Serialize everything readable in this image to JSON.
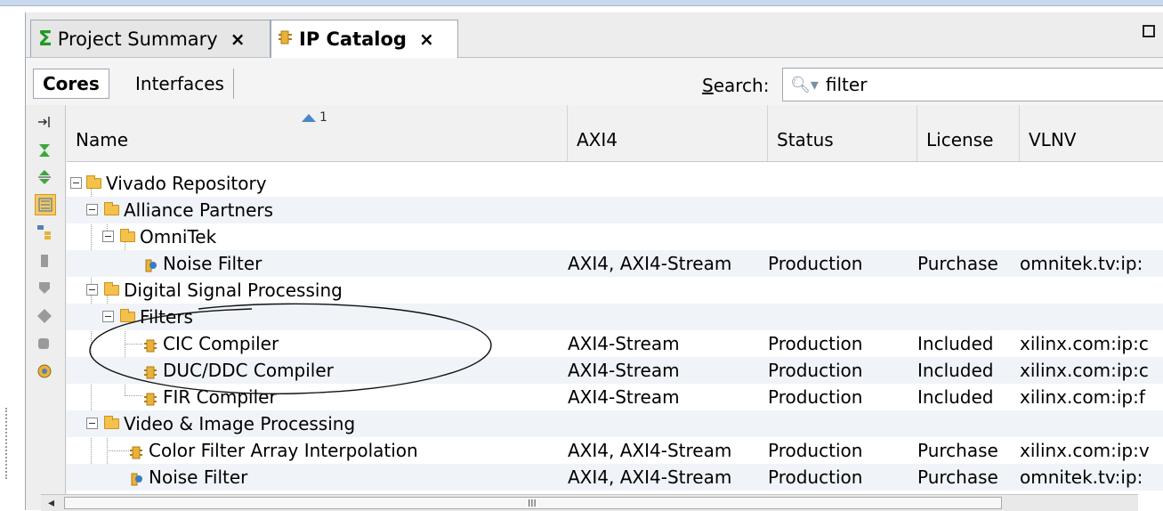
{
  "tabs": [
    {
      "label": "Project Summary",
      "icon": "sigma-icon",
      "active": false
    },
    {
      "label": "IP Catalog",
      "icon": "ip-core-icon",
      "active": true
    }
  ],
  "tab_close": "×",
  "subtabs": {
    "cores": "Cores",
    "interfaces": "Interfaces"
  },
  "search": {
    "label_first": "S",
    "label_rest": "earch:",
    "value": "filter"
  },
  "sort_indicator": "1",
  "columns": [
    "Name",
    "AXI4",
    "Status",
    "License",
    "VLNV"
  ],
  "rows": [
    {
      "name": "Vivado Repository",
      "axi": "",
      "status": "",
      "license": "",
      "vlnv": ""
    },
    {
      "name": "Alliance Partners",
      "axi": "",
      "status": "",
      "license": "",
      "vlnv": ""
    },
    {
      "name": "OmniTek",
      "axi": "",
      "status": "",
      "license": "",
      "vlnv": ""
    },
    {
      "name": "Noise Filter",
      "axi": "AXI4, AXI4-Stream",
      "status": "Production",
      "license": "Purchase",
      "vlnv": "omnitek.tv:ip:"
    },
    {
      "name": "Digital Signal Processing",
      "axi": "",
      "status": "",
      "license": "",
      "vlnv": ""
    },
    {
      "name": "Filters",
      "axi": "",
      "status": "",
      "license": "",
      "vlnv": ""
    },
    {
      "name": "CIC Compiler",
      "axi": "AXI4-Stream",
      "status": "Production",
      "license": "Included",
      "vlnv": "xilinx.com:ip:c"
    },
    {
      "name": "DUC/DDC Compiler",
      "axi": "AXI4-Stream",
      "status": "Production",
      "license": "Included",
      "vlnv": "xilinx.com:ip:c"
    },
    {
      "name": "FIR Compiler",
      "axi": "AXI4-Stream",
      "status": "Production",
      "license": "Included",
      "vlnv": "xilinx.com:ip:f"
    },
    {
      "name": "Video & Image Processing",
      "axi": "",
      "status": "",
      "license": "",
      "vlnv": ""
    },
    {
      "name": "Color Filter Array Interpolation",
      "axi": "AXI4, AXI4-Stream",
      "status": "Production",
      "license": "Purchase",
      "vlnv": "xilinx.com:ip:v"
    },
    {
      "name": "Noise Filter",
      "axi": "AXI4, AXI4-Stream",
      "status": "Production",
      "license": "Purchase",
      "vlnv": "omnitek.tv:ip:"
    }
  ],
  "sidebar_icons": [
    "collapse-icon",
    "expand-all-icon",
    "expand-icon",
    "group-by-icon",
    "hierarchy-icon",
    "compatible-icon",
    "addon-icon",
    "ip-icon",
    "repository-icon",
    "settings-icon"
  ],
  "colors": {
    "folder": "#f3c14c",
    "selected_tool": "#f6c862",
    "sigma": "#1f9a23",
    "row_alt": "#f0f3f8"
  }
}
